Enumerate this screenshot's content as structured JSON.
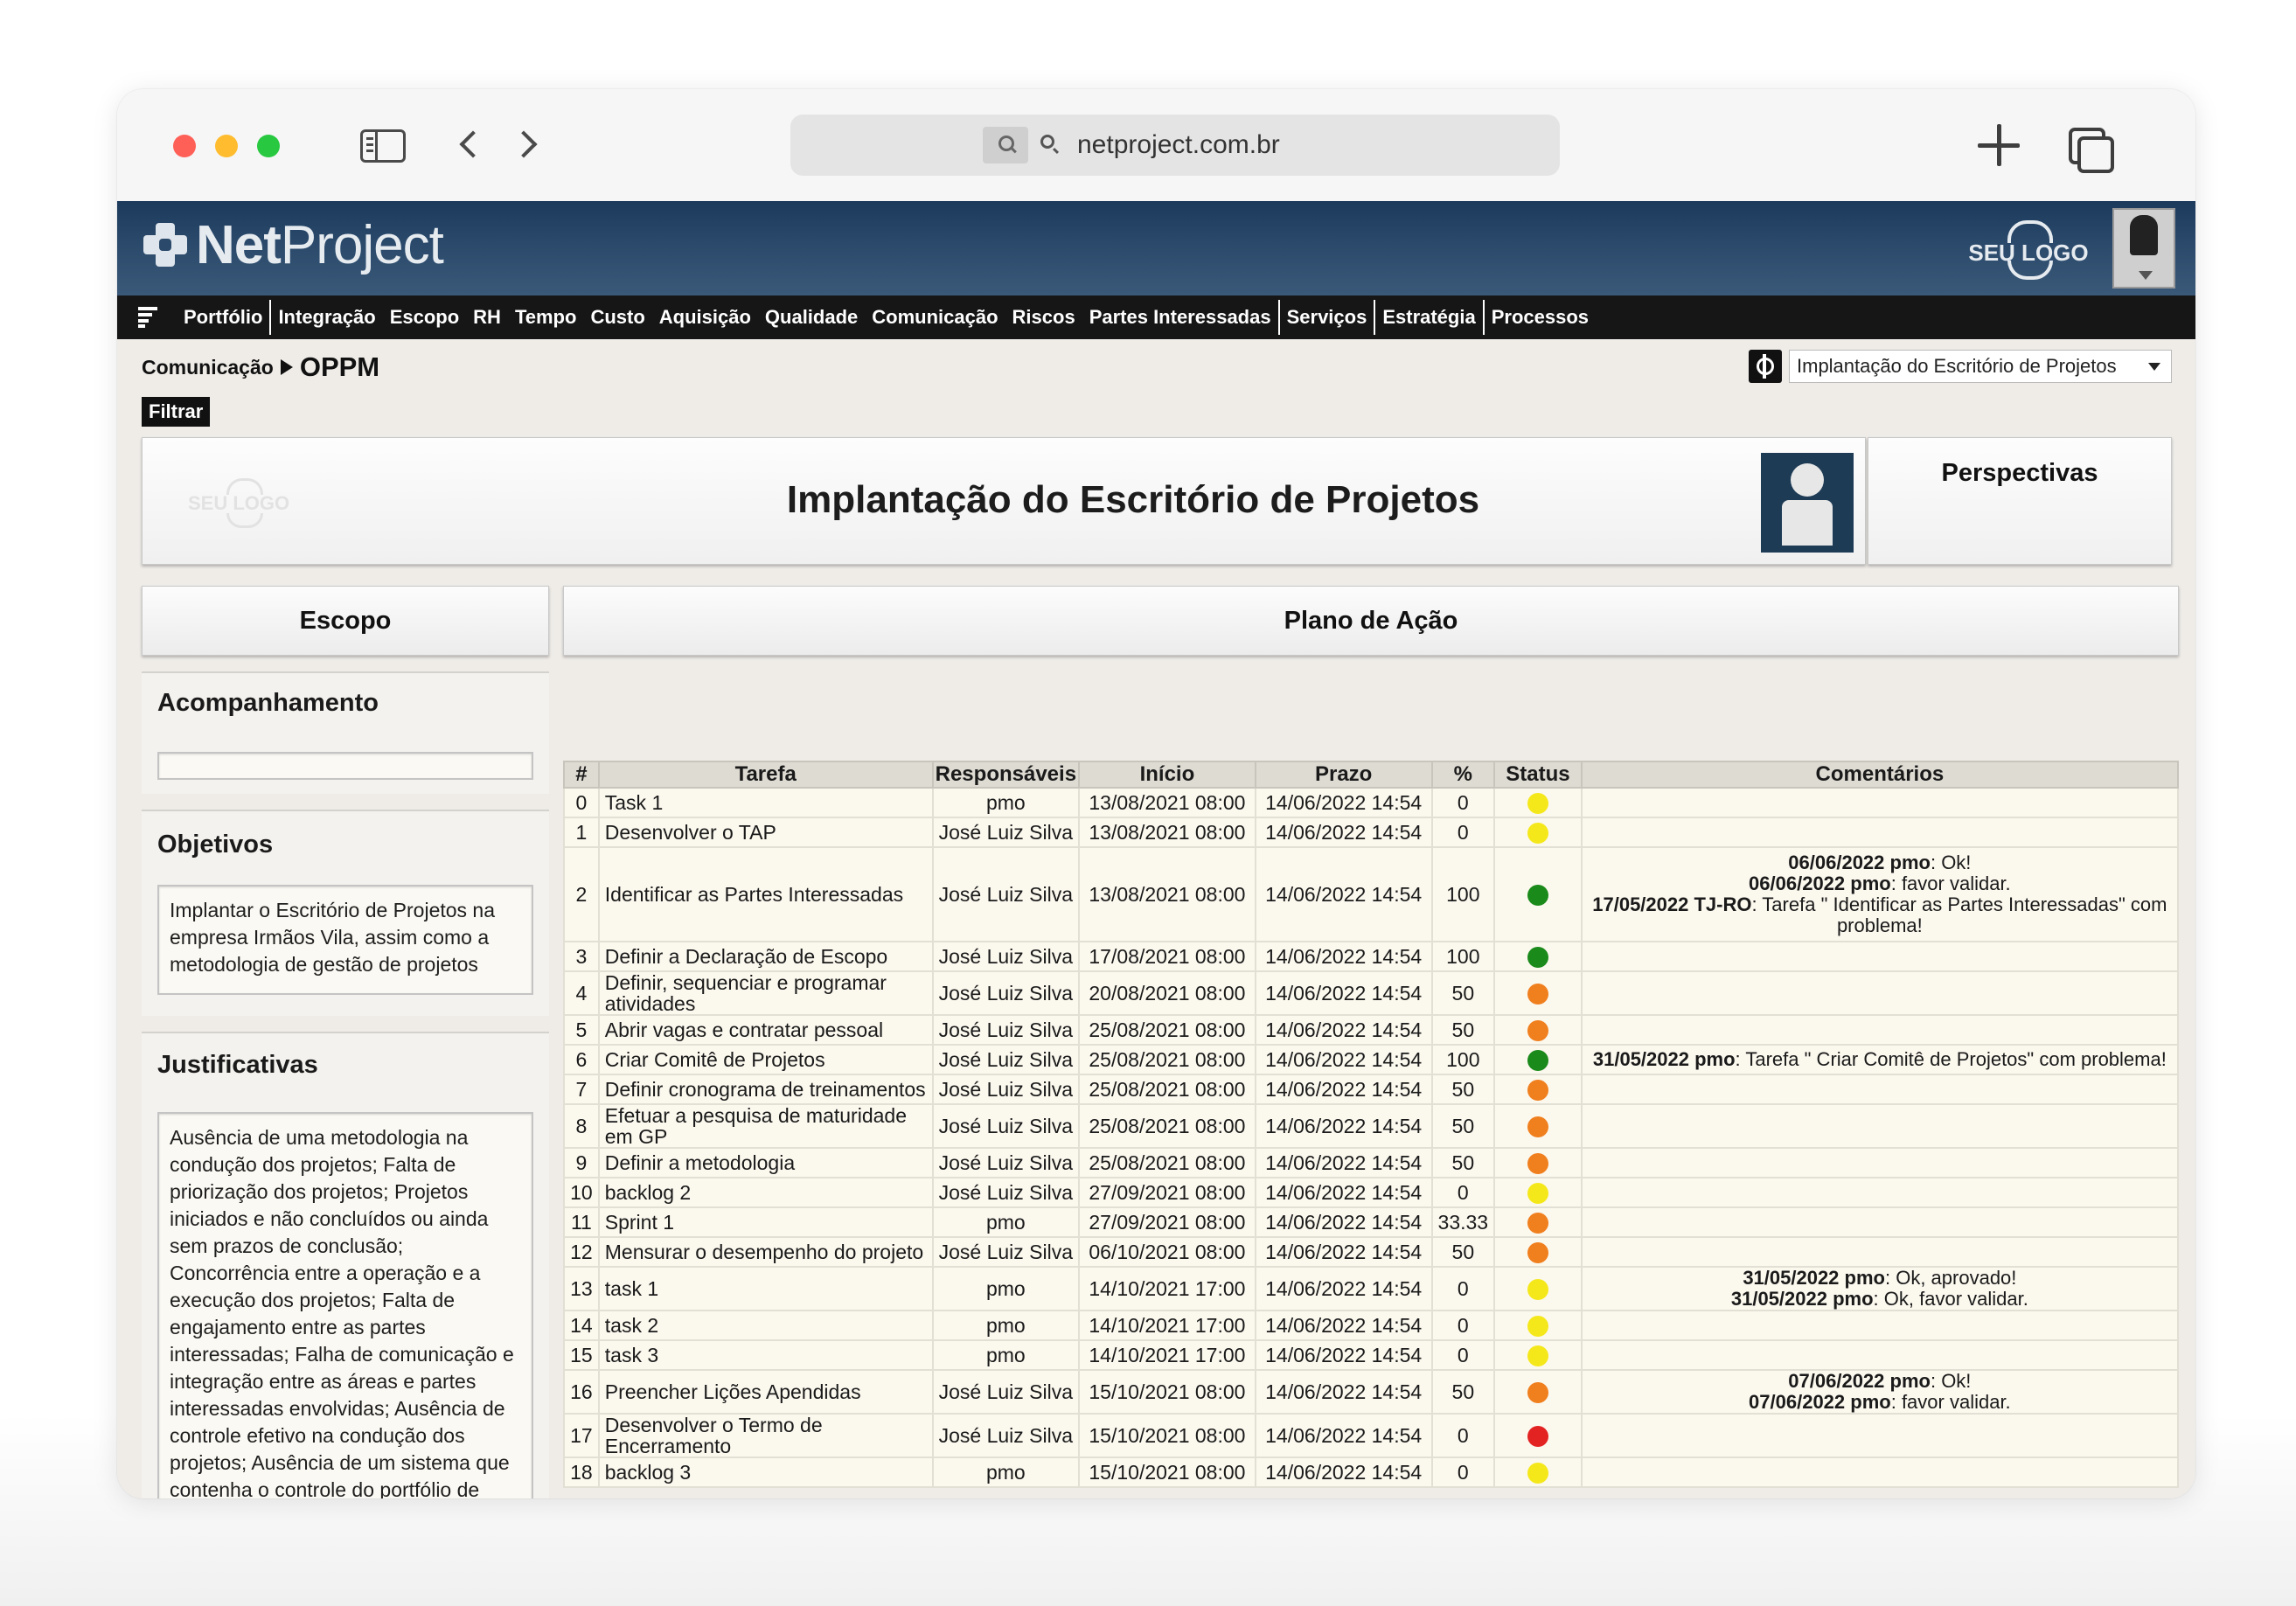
{
  "browser": {
    "url": "netproject.com.br"
  },
  "app": {
    "brand_bold": "Net",
    "brand_light": "Project",
    "client_logo": "SEU LOGO",
    "menu": [
      "Portfólio",
      "Integração",
      "Escopo",
      "RH",
      "Tempo",
      "Custo",
      "Aquisição",
      "Qualidade",
      "Comunicação",
      "Riscos",
      "Partes Interessadas",
      "Serviços",
      "Estratégia",
      "Processos"
    ]
  },
  "breadcrumb": {
    "section": "Comunicação",
    "page": "OPPM"
  },
  "project_select": {
    "value": "Implantação do Escritório de Projetos"
  },
  "filter_label": "Filtrar",
  "header": {
    "faint_logo": "SEU LOGO",
    "title": "Implantação do Escritório de Projetos",
    "perspectives": "Perspectivas"
  },
  "sections": {
    "scope": "Escopo",
    "action_plan": "Plano de Ação"
  },
  "sidebar": {
    "tracking": {
      "title": "Acompanhamento"
    },
    "objectives": {
      "title": "Objetivos",
      "text": "Implantar o Escritório de Projetos na empresa Irmãos Vila, assim como a metodologia de gestão de projetos"
    },
    "justifications": {
      "title": "Justificativas",
      "text": "Ausência de uma metodologia na condução dos projetos; Falta de priorização dos projetos; Projetos iniciados e não concluídos ou ainda sem prazos de conclusão; Concorrência entre a operação e a execução dos projetos; Falta de engajamento entre as partes interessadas; Falha de comunicação e integração entre as áreas e partes interessadas envolvidas; Ausência de controle efetivo na condução dos projetos; Ausência de um sistema que contenha o controle do portfólio de projetos e seus principais indicadores;"
    }
  },
  "table": {
    "columns": [
      "#",
      "Tarefa",
      "Responsáveis",
      "Início",
      "Prazo",
      "%",
      "Status",
      "Comentários"
    ],
    "status_colors": {
      "yellow": "#f5e81a",
      "green": "#1a8a1a",
      "orange": "#f07f1e",
      "red": "#e32222"
    },
    "rows": [
      {
        "n": "0",
        "task": "Task 1",
        "resp": "pmo",
        "start": "13/08/2021 08:00",
        "due": "14/06/2022 14:54",
        "pct": "0",
        "status": "yellow",
        "comments": []
      },
      {
        "n": "1",
        "task": "Desenvolver o TAP",
        "resp": "José Luiz Silva",
        "start": "13/08/2021 08:00",
        "due": "14/06/2022 14:54",
        "pct": "0",
        "status": "yellow",
        "comments": []
      },
      {
        "n": "2",
        "task": "Identificar as Partes Interessadas",
        "resp": "José Luiz Silva",
        "start": "13/08/2021 08:00",
        "due": "14/06/2022 14:54",
        "pct": "100",
        "status": "green",
        "comments": [
          {
            "who": "06/06/2022 pmo",
            "text": ": Ok!"
          },
          {
            "who": "06/06/2022 pmo",
            "text": ": favor validar."
          },
          {
            "who": "17/05/2022 TJ-RO",
            "text": ": Tarefa \" Identificar as Partes Interessadas\" com problema!"
          }
        ]
      },
      {
        "n": "3",
        "task": "Definir a Declaração de Escopo",
        "resp": "José Luiz Silva",
        "start": "17/08/2021 08:00",
        "due": "14/06/2022 14:54",
        "pct": "100",
        "status": "green",
        "comments": []
      },
      {
        "n": "4",
        "task": "Definir, sequenciar e programar atividades",
        "resp": "José Luiz Silva",
        "start": "20/08/2021 08:00",
        "due": "14/06/2022 14:54",
        "pct": "50",
        "status": "orange",
        "comments": []
      },
      {
        "n": "5",
        "task": "Abrir vagas e contratar pessoal",
        "resp": "José Luiz Silva",
        "start": "25/08/2021 08:00",
        "due": "14/06/2022 14:54",
        "pct": "50",
        "status": "orange",
        "comments": []
      },
      {
        "n": "6",
        "task": "Criar Comitê de Projetos",
        "resp": "José Luiz Silva",
        "start": "25/08/2021 08:00",
        "due": "14/06/2022 14:54",
        "pct": "100",
        "status": "green",
        "comments": [
          {
            "who": "31/05/2022 pmo",
            "text": ": Tarefa \" Criar Comitê de Projetos\" com problema!"
          }
        ]
      },
      {
        "n": "7",
        "task": "Definir cronograma de treinamentos",
        "resp": "José Luiz Silva",
        "start": "25/08/2021 08:00",
        "due": "14/06/2022 14:54",
        "pct": "50",
        "status": "orange",
        "comments": []
      },
      {
        "n": "8",
        "task": "Efetuar a pesquisa de maturidade em GP",
        "resp": "José Luiz Silva",
        "start": "25/08/2021 08:00",
        "due": "14/06/2022 14:54",
        "pct": "50",
        "status": "orange",
        "comments": []
      },
      {
        "n": "9",
        "task": "Definir a metodologia",
        "resp": "José Luiz Silva",
        "start": "25/08/2021 08:00",
        "due": "14/06/2022 14:54",
        "pct": "50",
        "status": "orange",
        "comments": []
      },
      {
        "n": "10",
        "task": "backlog 2",
        "resp": "José Luiz Silva",
        "start": "27/09/2021 08:00",
        "due": "14/06/2022 14:54",
        "pct": "0",
        "status": "yellow",
        "comments": []
      },
      {
        "n": "11",
        "task": "Sprint 1",
        "resp": "pmo",
        "start": "27/09/2021 08:00",
        "due": "14/06/2022 14:54",
        "pct": "33.33",
        "status": "orange",
        "comments": []
      },
      {
        "n": "12",
        "task": "Mensurar o desempenho do projeto",
        "resp": "José Luiz Silva",
        "start": "06/10/2021 08:00",
        "due": "14/06/2022 14:54",
        "pct": "50",
        "status": "orange",
        "comments": []
      },
      {
        "n": "13",
        "task": "task 1",
        "resp": "pmo",
        "start": "14/10/2021 17:00",
        "due": "14/06/2022 14:54",
        "pct": "0",
        "status": "yellow",
        "comments": [
          {
            "who": "31/05/2022 pmo",
            "text": ": Ok, aprovado!"
          },
          {
            "who": "31/05/2022 pmo",
            "text": ": Ok, favor validar."
          }
        ]
      },
      {
        "n": "14",
        "task": "task 2",
        "resp": "pmo",
        "start": "14/10/2021 17:00",
        "due": "14/06/2022 14:54",
        "pct": "0",
        "status": "yellow",
        "comments": []
      },
      {
        "n": "15",
        "task": "task 3",
        "resp": "pmo",
        "start": "14/10/2021 17:00",
        "due": "14/06/2022 14:54",
        "pct": "0",
        "status": "yellow",
        "comments": []
      },
      {
        "n": "16",
        "task": "Preencher Lições Apendidas",
        "resp": "José Luiz Silva",
        "start": "15/10/2021 08:00",
        "due": "14/06/2022 14:54",
        "pct": "50",
        "status": "orange",
        "comments": [
          {
            "who": "07/06/2022 pmo",
            "text": ": Ok!"
          },
          {
            "who": "07/06/2022 pmo",
            "text": ": favor validar."
          }
        ]
      },
      {
        "n": "17",
        "task": "Desenvolver o Termo de Encerramento",
        "resp": "José Luiz Silva",
        "start": "15/10/2021 08:00",
        "due": "14/06/2022 14:54",
        "pct": "0",
        "status": "red",
        "comments": []
      },
      {
        "n": "18",
        "task": "backlog 3",
        "resp": "pmo",
        "start": "15/10/2021 08:00",
        "due": "14/06/2022 14:54",
        "pct": "0",
        "status": "yellow",
        "comments": []
      }
    ]
  }
}
